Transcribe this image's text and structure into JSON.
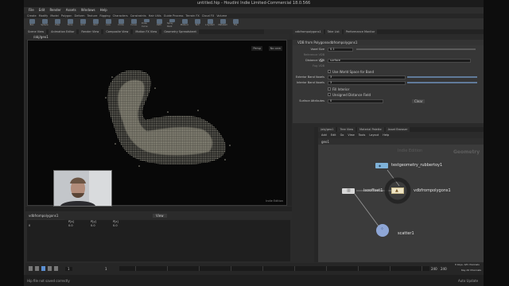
{
  "window": {
    "title": "untitled.hip - Houdini Indie Limited-Commercial 18.0.566"
  },
  "menubar": [
    "File",
    "Edit",
    "Render",
    "Assets",
    "Windows",
    "Help"
  ],
  "shelf_tabs": [
    "Create",
    "Modify",
    "Model",
    "Polygon",
    "Deform",
    "Texture",
    "Rigging",
    "Characters",
    "Constraints",
    "Hair Utils",
    "Guide Process",
    "Terrain FX",
    "Cloud FX",
    "Volume"
  ],
  "shelf_tools": [
    "Box",
    "Sphere",
    "Tube",
    "Torus",
    "Grid",
    "Null",
    "Line",
    "Circle",
    "Curve",
    "Draw Curve",
    "Path",
    "Spray Paint",
    "Platonic",
    "Text",
    "L-System",
    "Metaball",
    "File"
  ],
  "left_tabs": [
    "Scene View",
    "Animation Editor",
    "Render View",
    "Composite View",
    "Motion FX View",
    "Geometry Spreadsheet"
  ],
  "viewer": {
    "path": "/obj/geo1",
    "view_mode": "Persp",
    "camera": "No cam",
    "watermark": "Indie Edition"
  },
  "spreadsheet": {
    "tab": "Geometry Spreadsheet",
    "node": "vdbfrompolygons1",
    "view": "View",
    "columns": [
      "",
      "P[x]",
      "P[y]",
      "P[z]"
    ],
    "rows": [
      [
        "0",
        "0.0",
        "0.0",
        "0.0"
      ]
    ]
  },
  "playbar": {
    "frame": "1",
    "start": "1",
    "end": "240",
    "end2": "240",
    "keys_label": "0 keys, 0/0 channels",
    "key_all": "Key All Channels",
    "auto_update": "Auto Update"
  },
  "right_tabs": [
    "vdbfrompolygons1",
    "Take List",
    "Performance Monitor"
  ],
  "param_pane": {
    "node_type": "VDB from Polygons",
    "node_name": "vdbfrompolygons1",
    "params": [
      {
        "label": "Voxel Size",
        "value": "0.1"
      },
      {
        "label": "Reference VDB",
        "value": ""
      },
      {
        "label": "Distance VDB",
        "value": "surface"
      },
      {
        "label": "Fog VDB",
        "value": ""
      },
      {
        "label": "Use World Space for Band",
        "value": ""
      },
      {
        "label": "Exterior Band Voxels",
        "value": "3"
      },
      {
        "label": "Interior Band Voxels",
        "value": "3"
      },
      {
        "label": "Fill Interior",
        "value": ""
      },
      {
        "label": "Unsigned Distance Field",
        "value": ""
      },
      {
        "label": "Surface Attributes",
        "value": "0"
      }
    ],
    "clear_label": "Clear"
  },
  "network": {
    "tabs": [
      "/obj/geo1",
      "Tree View",
      "Material Palette",
      "Asset Browser"
    ],
    "menu": [
      "Add",
      "Edit",
      "Go",
      "View",
      "Tools",
      "Layout",
      "Help"
    ],
    "path": "geo1",
    "context_label": "Indie Edition",
    "context_type": "Geometry",
    "nodes": {
      "rubbertoy": "testgeometry_rubbertoy1",
      "isooffset": "isooffset1",
      "vdb": "vdbfrompolygons1",
      "scatter": "scatter1"
    }
  },
  "status": {
    "text": "Hip file not saved correctly"
  }
}
